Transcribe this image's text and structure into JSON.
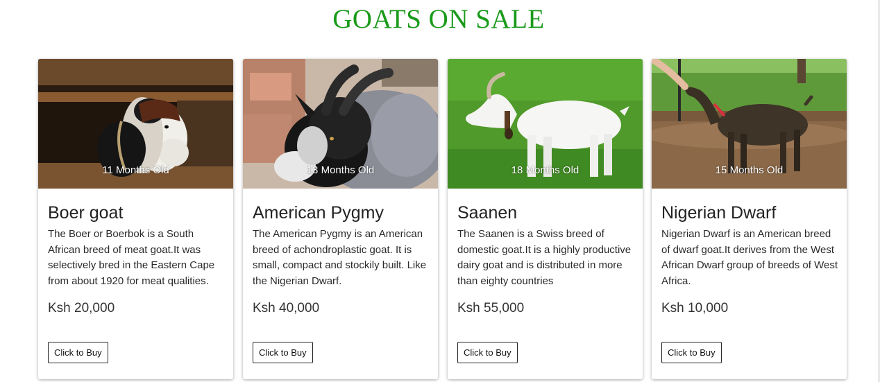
{
  "page": {
    "title": "GOATS ON SALE",
    "title_color": "#1a9a1a"
  },
  "goats": [
    {
      "name": "Boer goat",
      "age": "11 Months Old",
      "description": "The Boer or Boerbok is a South African breed of meat goat.It was selectively bred in the Eastern Cape from about 1920 for meat qualities.",
      "price": "Ksh 20,000",
      "button": "Click to Buy",
      "image": "boer-goat-photo"
    },
    {
      "name": "American Pygmy",
      "age": "13 Months Old",
      "description": "The American Pygmy is an American breed of achondroplastic goat. It is small, compact and stockily built. Like the Nigerian Dwarf.",
      "price": "Ksh 40,000",
      "button": "Click to Buy",
      "image": "american-pygmy-goat-photo"
    },
    {
      "name": "Saanen",
      "age": "18 Months Old",
      "description": "The Saanen is a Swiss breed of domestic goat.It is a highly productive dairy goat and is distributed in more than eighty countries",
      "price": "Ksh 55,000",
      "button": "Click to Buy",
      "image": "saanen-goat-photo"
    },
    {
      "name": "Nigerian Dwarf",
      "age": "15 Months Old",
      "description": "Nigerian Dwarf is an American breed of dwarf goat.It derives from the West African Dwarf group of breeds of West Africa.",
      "price": "Ksh 10,000",
      "button": "Click to Buy",
      "image": "nigerian-dwarf-goat-photo"
    }
  ]
}
